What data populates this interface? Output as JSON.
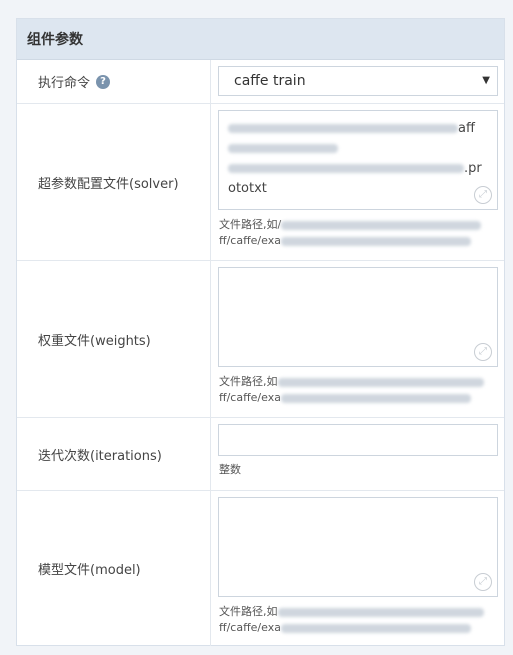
{
  "header": {
    "title": "组件参数"
  },
  "rows": {
    "command": {
      "label": "执行命令",
      "help_icon": "?",
      "select_value": "caffe train",
      "arrow": "▼"
    },
    "solver": {
      "label": "超参数配置文件(solver)",
      "value_tail_1": "aff",
      "value_tail_2": ".pr",
      "value_line_3": "ototxt",
      "hint_prefix": "文件路径,如/",
      "hint_line2": "ff/caffe/exa"
    },
    "weights": {
      "label": "权重文件(weights)",
      "hint_prefix": "文件路径,如",
      "hint_line2": "ff/caffe/exa"
    },
    "iterations": {
      "label": "迭代次数(iterations)",
      "hint": "整数"
    },
    "model": {
      "label": "模型文件(model)",
      "hint_prefix": "文件路径,如",
      "hint_line2": "ff/caffe/exa"
    }
  },
  "icons": {
    "resize": "expand-diagonal-icon",
    "help": "question-circle-icon"
  }
}
